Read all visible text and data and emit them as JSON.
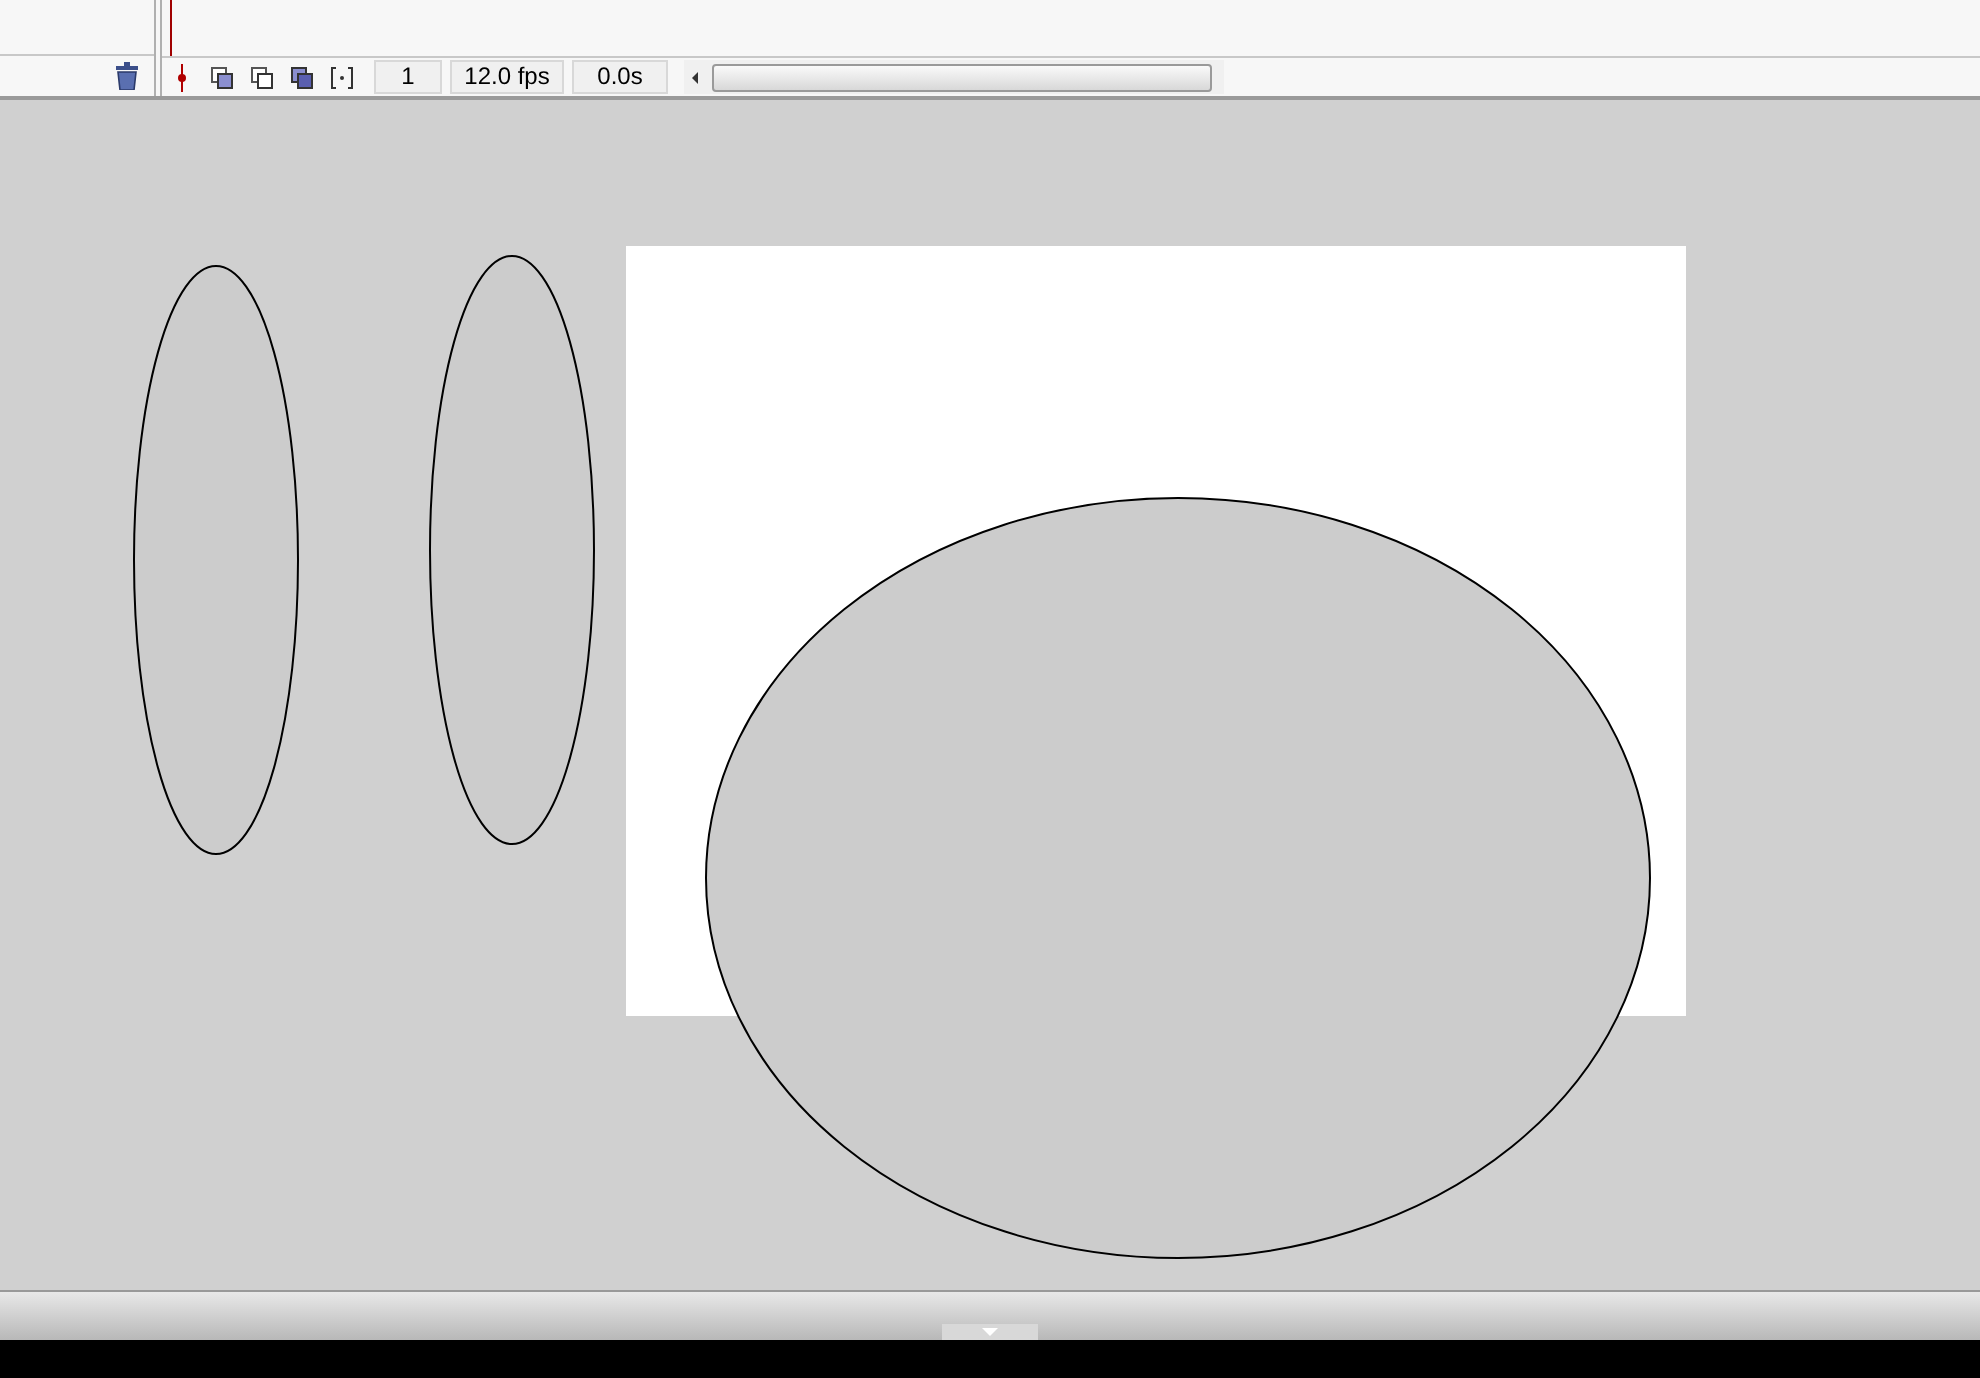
{
  "timeline_status": {
    "current_frame": "1",
    "frame_rate": "12.0 fps",
    "elapsed_time": "0.0s"
  }
}
